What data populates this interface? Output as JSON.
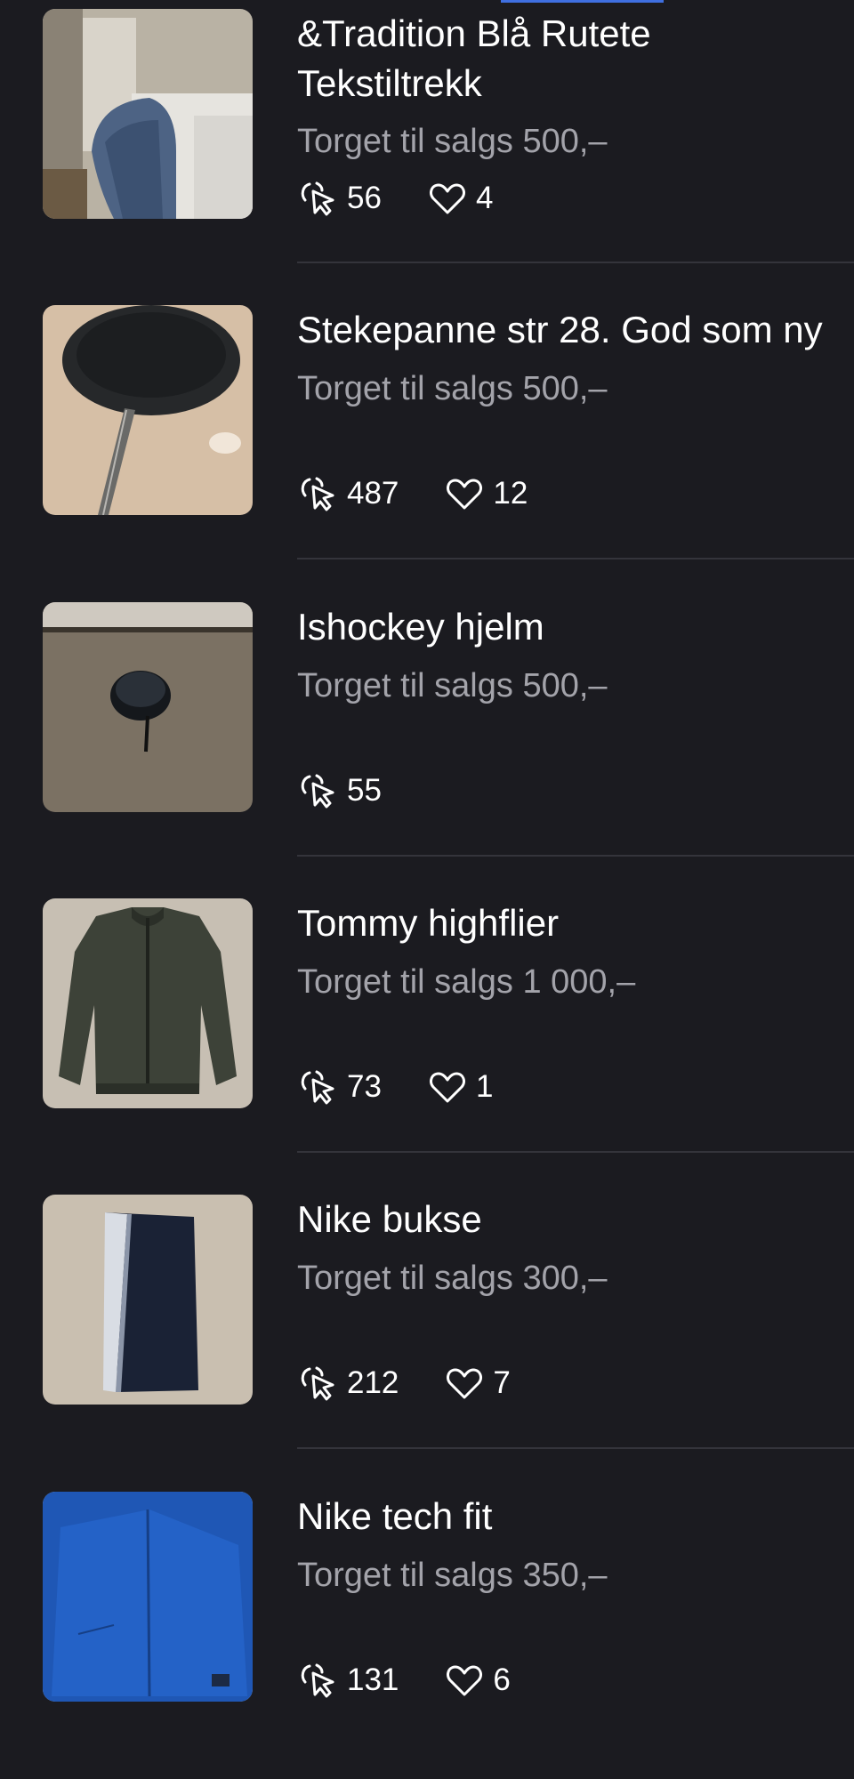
{
  "listings": [
    {
      "title": "&Tradition Blå Rutete Tekstiltrekk",
      "price": "Torget til salgs 500,–",
      "clicks": "56",
      "likes": "4"
    },
    {
      "title": "Stekepanne str 28. God som ny",
      "price": "Torget til salgs 500,–",
      "clicks": "487",
      "likes": "12"
    },
    {
      "title": "Ishockey hjelm",
      "price": "Torget til salgs 500,–",
      "clicks": "55",
      "likes": ""
    },
    {
      "title": "Tommy highflier",
      "price": "Torget til salgs 1 000,–",
      "clicks": "73",
      "likes": "1"
    },
    {
      "title": "Nike bukse",
      "price": "Torget til salgs 300,–",
      "clicks": "212",
      "likes": "7"
    },
    {
      "title": "Nike tech fit",
      "price": "Torget til salgs 350,–",
      "clicks": "131",
      "likes": "6"
    }
  ],
  "icons": {
    "clicks": "cursor-click-icon",
    "likes": "heart-icon"
  },
  "colors": {
    "background": "#1b1b20",
    "price_text": "#a3a3aa",
    "divider": "#34343b",
    "accent": "#3f6fe0"
  }
}
